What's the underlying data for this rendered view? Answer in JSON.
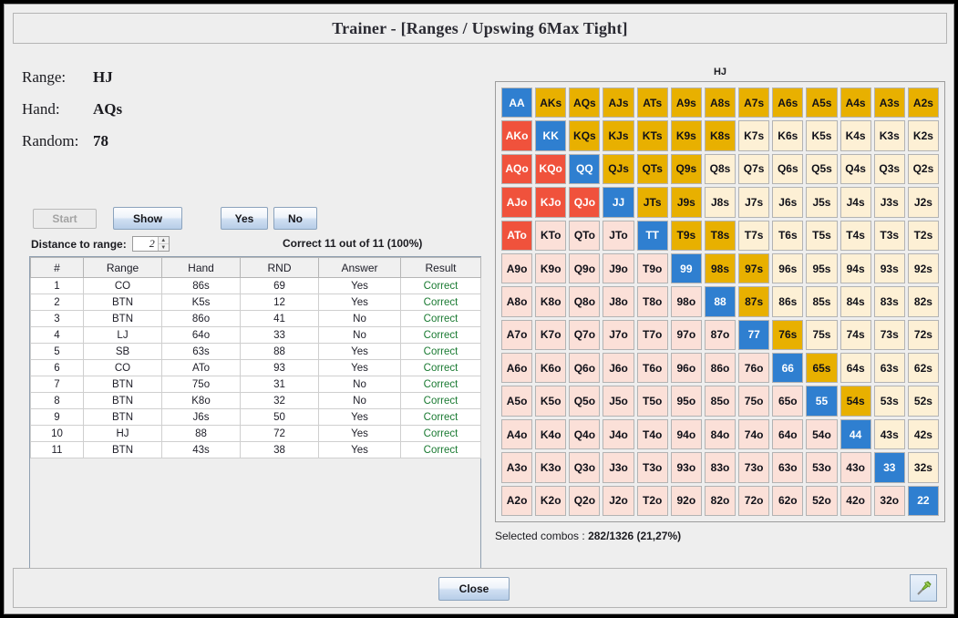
{
  "window": {
    "title": "Trainer - [Ranges / Upswing 6Max Tight]"
  },
  "info": {
    "range_label": "Range:",
    "range_value": "HJ",
    "hand_label": "Hand:",
    "hand_value": "AQs",
    "random_label": "Random:",
    "random_value": "78"
  },
  "buttons": {
    "start": "Start",
    "show": "Show",
    "yes": "Yes",
    "no": "No",
    "close": "Close"
  },
  "distance": {
    "label": "Distance to range:",
    "value": "2",
    "up": "▲",
    "down": "▼"
  },
  "score": "Correct 11 out of 11 (100%)",
  "history": {
    "columns": [
      "#",
      "Range",
      "Hand",
      "RND",
      "Answer",
      "Result"
    ],
    "rows": [
      [
        "1",
        "CO",
        "86s",
        "69",
        "Yes",
        "Correct"
      ],
      [
        "2",
        "BTN",
        "K5s",
        "12",
        "Yes",
        "Correct"
      ],
      [
        "3",
        "BTN",
        "86o",
        "41",
        "No",
        "Correct"
      ],
      [
        "4",
        "LJ",
        "64o",
        "33",
        "No",
        "Correct"
      ],
      [
        "5",
        "SB",
        "63s",
        "88",
        "Yes",
        "Correct"
      ],
      [
        "6",
        "CO",
        "ATo",
        "93",
        "Yes",
        "Correct"
      ],
      [
        "7",
        "BTN",
        "75o",
        "31",
        "No",
        "Correct"
      ],
      [
        "8",
        "BTN",
        "K8o",
        "32",
        "No",
        "Correct"
      ],
      [
        "9",
        "BTN",
        "J6s",
        "50",
        "Yes",
        "Correct"
      ],
      [
        "10",
        "HJ",
        "88",
        "72",
        "Yes",
        "Correct"
      ],
      [
        "11",
        "BTN",
        "43s",
        "38",
        "Yes",
        "Correct"
      ]
    ]
  },
  "range_grid": {
    "title": "HJ",
    "combos_label": "Selected combos : ",
    "combos_value": "282/1326 (21,27%)",
    "colors": {
      "pair_selected": "#2f7fd0",
      "suited_selected": "#e8b000",
      "offsuit_selected": "#f0523c",
      "suited_none": "#fdf0d5",
      "offsuit_none": "#fbe0d8"
    },
    "ranks": [
      "A",
      "K",
      "Q",
      "J",
      "T",
      "9",
      "8",
      "7",
      "6",
      "5",
      "4",
      "3",
      "2"
    ],
    "cells": [
      [
        {
          "t": "AA",
          "s": "pair"
        },
        {
          "t": "AKs",
          "s": "ssel"
        },
        {
          "t": "AQs",
          "s": "ssel"
        },
        {
          "t": "AJs",
          "s": "ssel"
        },
        {
          "t": "ATs",
          "s": "ssel"
        },
        {
          "t": "A9s",
          "s": "ssel"
        },
        {
          "t": "A8s",
          "s": "ssel"
        },
        {
          "t": "A7s",
          "s": "ssel"
        },
        {
          "t": "A6s",
          "s": "ssel"
        },
        {
          "t": "A5s",
          "s": "ssel"
        },
        {
          "t": "A4s",
          "s": "ssel"
        },
        {
          "t": "A3s",
          "s": "ssel"
        },
        {
          "t": "A2s",
          "s": "ssel"
        }
      ],
      [
        {
          "t": "AKo",
          "s": "osel"
        },
        {
          "t": "KK",
          "s": "pair"
        },
        {
          "t": "KQs",
          "s": "ssel"
        },
        {
          "t": "KJs",
          "s": "ssel"
        },
        {
          "t": "KTs",
          "s": "ssel"
        },
        {
          "t": "K9s",
          "s": "ssel"
        },
        {
          "t": "K8s",
          "s": "ssel"
        },
        {
          "t": "K7s",
          "s": "snone"
        },
        {
          "t": "K6s",
          "s": "snone"
        },
        {
          "t": "K5s",
          "s": "snone"
        },
        {
          "t": "K4s",
          "s": "snone"
        },
        {
          "t": "K3s",
          "s": "snone"
        },
        {
          "t": "K2s",
          "s": "snone"
        }
      ],
      [
        {
          "t": "AQo",
          "s": "osel"
        },
        {
          "t": "KQo",
          "s": "osel"
        },
        {
          "t": "QQ",
          "s": "pair"
        },
        {
          "t": "QJs",
          "s": "ssel"
        },
        {
          "t": "QTs",
          "s": "ssel"
        },
        {
          "t": "Q9s",
          "s": "ssel"
        },
        {
          "t": "Q8s",
          "s": "snone"
        },
        {
          "t": "Q7s",
          "s": "snone"
        },
        {
          "t": "Q6s",
          "s": "snone"
        },
        {
          "t": "Q5s",
          "s": "snone"
        },
        {
          "t": "Q4s",
          "s": "snone"
        },
        {
          "t": "Q3s",
          "s": "snone"
        },
        {
          "t": "Q2s",
          "s": "snone"
        }
      ],
      [
        {
          "t": "AJo",
          "s": "osel"
        },
        {
          "t": "KJo",
          "s": "osel"
        },
        {
          "t": "QJo",
          "s": "osel"
        },
        {
          "t": "JJ",
          "s": "pair"
        },
        {
          "t": "JTs",
          "s": "ssel"
        },
        {
          "t": "J9s",
          "s": "ssel"
        },
        {
          "t": "J8s",
          "s": "snone"
        },
        {
          "t": "J7s",
          "s": "snone"
        },
        {
          "t": "J6s",
          "s": "snone"
        },
        {
          "t": "J5s",
          "s": "snone"
        },
        {
          "t": "J4s",
          "s": "snone"
        },
        {
          "t": "J3s",
          "s": "snone"
        },
        {
          "t": "J2s",
          "s": "snone"
        }
      ],
      [
        {
          "t": "ATo",
          "s": "osel"
        },
        {
          "t": "KTo",
          "s": "onone"
        },
        {
          "t": "QTo",
          "s": "onone"
        },
        {
          "t": "JTo",
          "s": "onone"
        },
        {
          "t": "TT",
          "s": "pair"
        },
        {
          "t": "T9s",
          "s": "ssel"
        },
        {
          "t": "T8s",
          "s": "ssel"
        },
        {
          "t": "T7s",
          "s": "snone"
        },
        {
          "t": "T6s",
          "s": "snone"
        },
        {
          "t": "T5s",
          "s": "snone"
        },
        {
          "t": "T4s",
          "s": "snone"
        },
        {
          "t": "T3s",
          "s": "snone"
        },
        {
          "t": "T2s",
          "s": "snone"
        }
      ],
      [
        {
          "t": "A9o",
          "s": "onone"
        },
        {
          "t": "K9o",
          "s": "onone"
        },
        {
          "t": "Q9o",
          "s": "onone"
        },
        {
          "t": "J9o",
          "s": "onone"
        },
        {
          "t": "T9o",
          "s": "onone"
        },
        {
          "t": "99",
          "s": "pair"
        },
        {
          "t": "98s",
          "s": "ssel"
        },
        {
          "t": "97s",
          "s": "ssel"
        },
        {
          "t": "96s",
          "s": "snone"
        },
        {
          "t": "95s",
          "s": "snone"
        },
        {
          "t": "94s",
          "s": "snone"
        },
        {
          "t": "93s",
          "s": "snone"
        },
        {
          "t": "92s",
          "s": "snone"
        }
      ],
      [
        {
          "t": "A8o",
          "s": "onone"
        },
        {
          "t": "K8o",
          "s": "onone"
        },
        {
          "t": "Q8o",
          "s": "onone"
        },
        {
          "t": "J8o",
          "s": "onone"
        },
        {
          "t": "T8o",
          "s": "onone"
        },
        {
          "t": "98o",
          "s": "onone"
        },
        {
          "t": "88",
          "s": "pair"
        },
        {
          "t": "87s",
          "s": "ssel"
        },
        {
          "t": "86s",
          "s": "snone"
        },
        {
          "t": "85s",
          "s": "snone"
        },
        {
          "t": "84s",
          "s": "snone"
        },
        {
          "t": "83s",
          "s": "snone"
        },
        {
          "t": "82s",
          "s": "snone"
        }
      ],
      [
        {
          "t": "A7o",
          "s": "onone"
        },
        {
          "t": "K7o",
          "s": "onone"
        },
        {
          "t": "Q7o",
          "s": "onone"
        },
        {
          "t": "J7o",
          "s": "onone"
        },
        {
          "t": "T7o",
          "s": "onone"
        },
        {
          "t": "97o",
          "s": "onone"
        },
        {
          "t": "87o",
          "s": "onone"
        },
        {
          "t": "77",
          "s": "pair"
        },
        {
          "t": "76s",
          "s": "ssel"
        },
        {
          "t": "75s",
          "s": "snone"
        },
        {
          "t": "74s",
          "s": "snone"
        },
        {
          "t": "73s",
          "s": "snone"
        },
        {
          "t": "72s",
          "s": "snone"
        }
      ],
      [
        {
          "t": "A6o",
          "s": "onone"
        },
        {
          "t": "K6o",
          "s": "onone"
        },
        {
          "t": "Q6o",
          "s": "onone"
        },
        {
          "t": "J6o",
          "s": "onone"
        },
        {
          "t": "T6o",
          "s": "onone"
        },
        {
          "t": "96o",
          "s": "onone"
        },
        {
          "t": "86o",
          "s": "onone"
        },
        {
          "t": "76o",
          "s": "onone"
        },
        {
          "t": "66",
          "s": "pair"
        },
        {
          "t": "65s",
          "s": "ssel"
        },
        {
          "t": "64s",
          "s": "snone"
        },
        {
          "t": "63s",
          "s": "snone"
        },
        {
          "t": "62s",
          "s": "snone"
        }
      ],
      [
        {
          "t": "A5o",
          "s": "onone"
        },
        {
          "t": "K5o",
          "s": "onone"
        },
        {
          "t": "Q5o",
          "s": "onone"
        },
        {
          "t": "J5o",
          "s": "onone"
        },
        {
          "t": "T5o",
          "s": "onone"
        },
        {
          "t": "95o",
          "s": "onone"
        },
        {
          "t": "85o",
          "s": "onone"
        },
        {
          "t": "75o",
          "s": "onone"
        },
        {
          "t": "65o",
          "s": "onone"
        },
        {
          "t": "55",
          "s": "pair"
        },
        {
          "t": "54s",
          "s": "ssel"
        },
        {
          "t": "53s",
          "s": "snone"
        },
        {
          "t": "52s",
          "s": "snone"
        }
      ],
      [
        {
          "t": "A4o",
          "s": "onone"
        },
        {
          "t": "K4o",
          "s": "onone"
        },
        {
          "t": "Q4o",
          "s": "onone"
        },
        {
          "t": "J4o",
          "s": "onone"
        },
        {
          "t": "T4o",
          "s": "onone"
        },
        {
          "t": "94o",
          "s": "onone"
        },
        {
          "t": "84o",
          "s": "onone"
        },
        {
          "t": "74o",
          "s": "onone"
        },
        {
          "t": "64o",
          "s": "onone"
        },
        {
          "t": "54o",
          "s": "onone"
        },
        {
          "t": "44",
          "s": "pair"
        },
        {
          "t": "43s",
          "s": "snone"
        },
        {
          "t": "42s",
          "s": "snone"
        }
      ],
      [
        {
          "t": "A3o",
          "s": "onone"
        },
        {
          "t": "K3o",
          "s": "onone"
        },
        {
          "t": "Q3o",
          "s": "onone"
        },
        {
          "t": "J3o",
          "s": "onone"
        },
        {
          "t": "T3o",
          "s": "onone"
        },
        {
          "t": "93o",
          "s": "onone"
        },
        {
          "t": "83o",
          "s": "onone"
        },
        {
          "t": "73o",
          "s": "onone"
        },
        {
          "t": "63o",
          "s": "onone"
        },
        {
          "t": "53o",
          "s": "onone"
        },
        {
          "t": "43o",
          "s": "onone"
        },
        {
          "t": "33",
          "s": "pair"
        },
        {
          "t": "32s",
          "s": "snone"
        }
      ],
      [
        {
          "t": "A2o",
          "s": "onone"
        },
        {
          "t": "K2o",
          "s": "onone"
        },
        {
          "t": "Q2o",
          "s": "onone"
        },
        {
          "t": "J2o",
          "s": "onone"
        },
        {
          "t": "T2o",
          "s": "onone"
        },
        {
          "t": "92o",
          "s": "onone"
        },
        {
          "t": "82o",
          "s": "onone"
        },
        {
          "t": "72o",
          "s": "onone"
        },
        {
          "t": "62o",
          "s": "onone"
        },
        {
          "t": "52o",
          "s": "onone"
        },
        {
          "t": "42o",
          "s": "onone"
        },
        {
          "t": "32o",
          "s": "onone"
        },
        {
          "t": "22",
          "s": "pair"
        }
      ]
    ]
  },
  "footer": {
    "pin_icon": "pin-icon"
  }
}
